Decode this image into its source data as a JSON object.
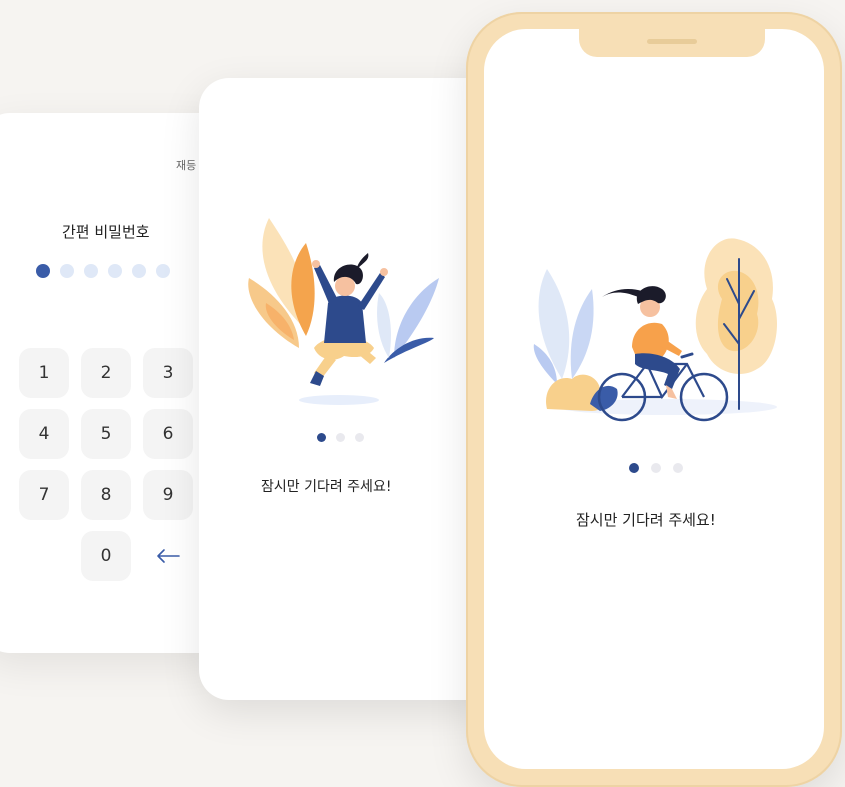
{
  "pin_screen": {
    "top_label": "재등",
    "title": "간편 비밀번호",
    "dots_total": 6,
    "dots_filled": 1,
    "keys": [
      "1",
      "2",
      "3",
      "4",
      "5",
      "6",
      "7",
      "8",
      "9",
      "0"
    ],
    "back_icon": "arrow-left-icon"
  },
  "loading_screen_mid": {
    "message": "잠시만 기다려 주세요!",
    "page_dots": 3,
    "active_dot": 1
  },
  "loading_screen_phone": {
    "message": "잠시만 기다려 주세요!",
    "page_dots": 3,
    "active_dot": 1
  },
  "colors": {
    "background": "#f6f4f1",
    "accent_blue": "#2d4a8c",
    "pin_dot_filled": "#3a5ca8",
    "pin_dot_empty": "#dfe8f7",
    "phone_frame": "#f7dfb6",
    "orange": "#f7a14b",
    "light_orange": "#fbe2b8"
  }
}
